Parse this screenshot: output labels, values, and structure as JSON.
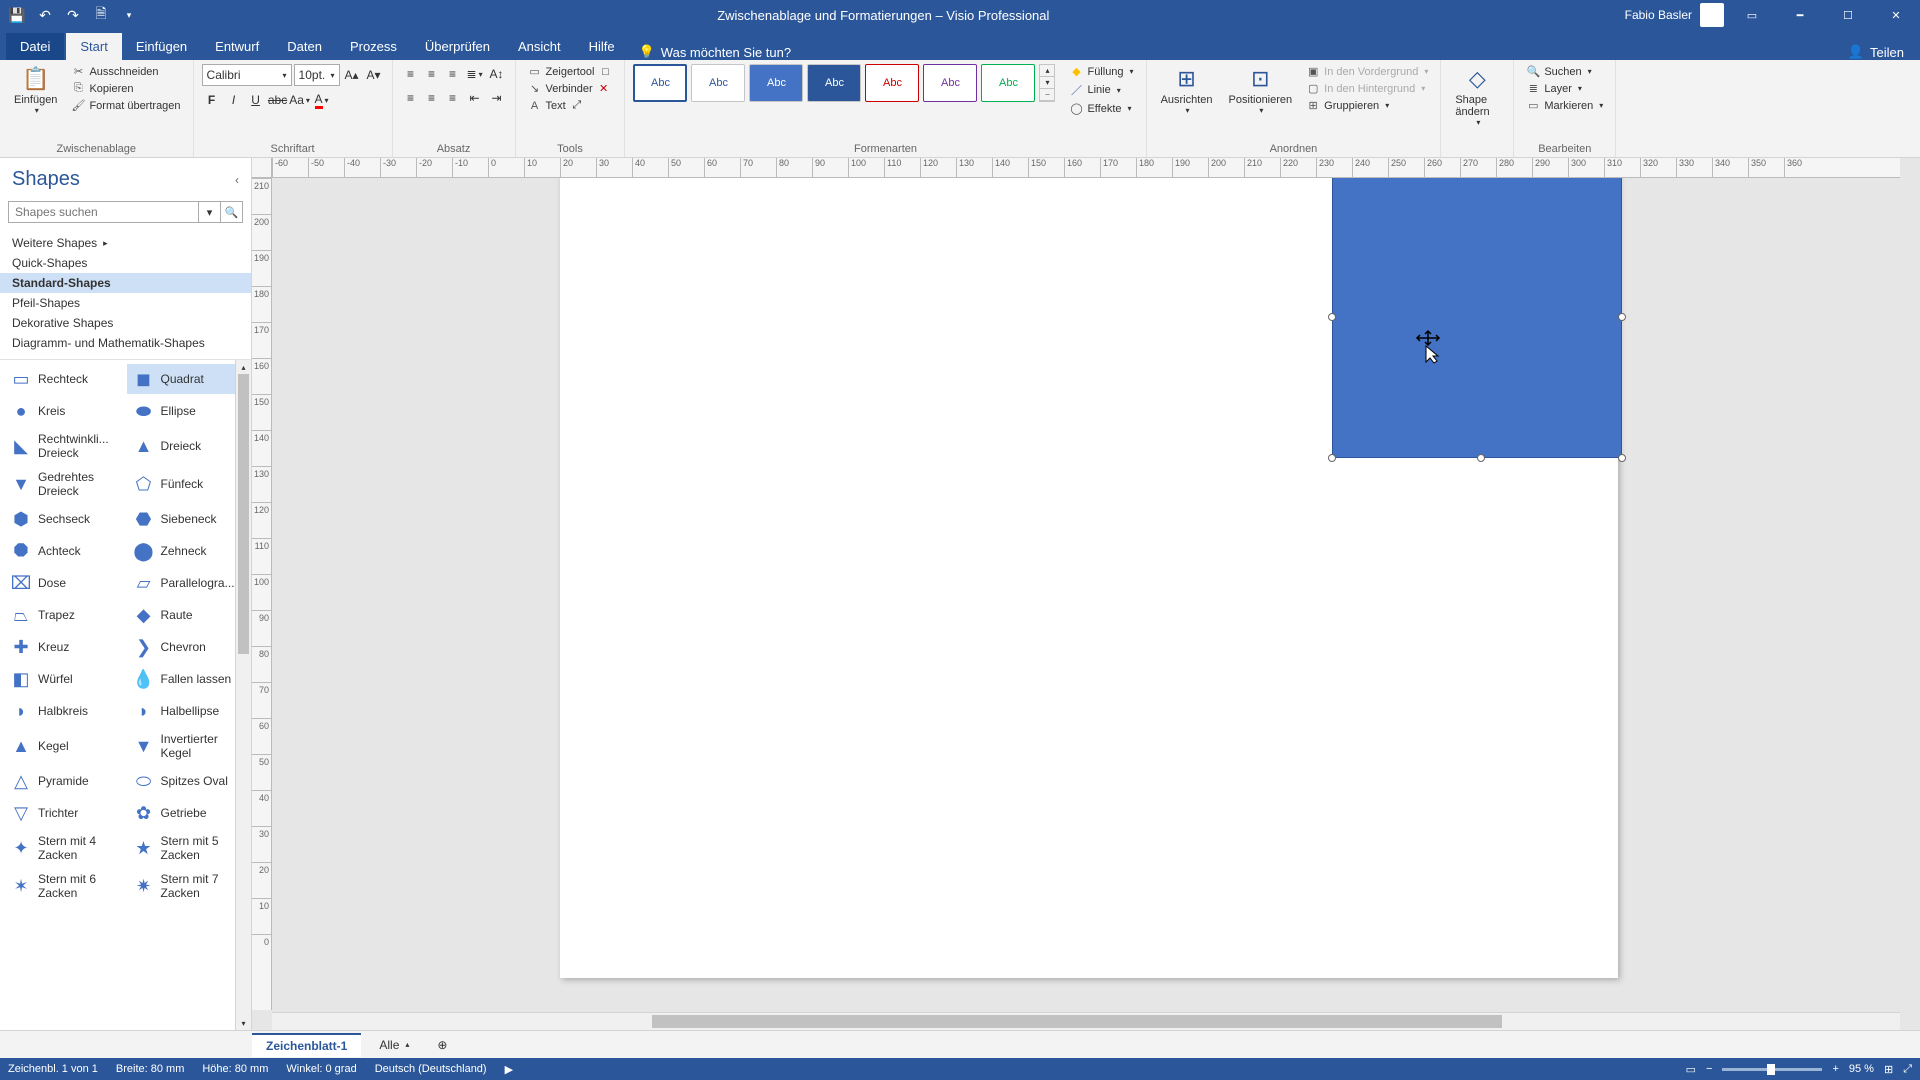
{
  "title": "Zwischenablage und Formatierungen  –  Visio Professional",
  "user": "Fabio Basler",
  "qat": {
    "save": "💾",
    "undo": "↶",
    "redo": "↷",
    "new": "🗎"
  },
  "tabs": [
    "Datei",
    "Start",
    "Einfügen",
    "Entwurf",
    "Daten",
    "Prozess",
    "Überprüfen",
    "Ansicht",
    "Hilfe"
  ],
  "tellme_placeholder": "Was möchten Sie tun?",
  "share": "Teilen",
  "ribbon": {
    "clipboard": {
      "paste": "Einfügen",
      "cut": "Ausschneiden",
      "copy": "Kopieren",
      "painter": "Format übertragen",
      "group": "Zwischenablage"
    },
    "font": {
      "name": "Calibri",
      "size": "10pt.",
      "group": "Schriftart"
    },
    "paragraph": {
      "group": "Absatz"
    },
    "tools": {
      "pointer": "Zeigertool",
      "connector": "Verbinder",
      "text": "Text",
      "group": "Tools"
    },
    "styles": {
      "abc": "Abc",
      "group": "Formenarten",
      "fill": "Füllung",
      "line": "Linie",
      "effects": "Effekte"
    },
    "arrange": {
      "align": "Ausrichten",
      "position": "Positionieren",
      "front": "In den Vordergrund",
      "back": "In den Hintergrund",
      "groupcmd": "Gruppieren",
      "group": "Anordnen"
    },
    "shape": {
      "change": "Shape ändern",
      "group": ""
    },
    "editing": {
      "find": "Suchen",
      "layer": "Layer",
      "select": "Markieren",
      "group": "Bearbeiten"
    }
  },
  "shapes_panel": {
    "title": "Shapes",
    "search_placeholder": "Shapes suchen",
    "stencils": [
      "Weitere Shapes",
      "Quick-Shapes",
      "Standard-Shapes",
      "Pfeil-Shapes",
      "Dekorative Shapes",
      "Diagramm- und Mathematik-Shapes"
    ],
    "active_stencil": 2,
    "shapes": [
      {
        "n": "Rechteck",
        "i": "▭"
      },
      {
        "n": "Quadrat",
        "i": "◼"
      },
      {
        "n": "Kreis",
        "i": "●"
      },
      {
        "n": "Ellipse",
        "i": "⬬"
      },
      {
        "n": "Rechtwinkli... Dreieck",
        "i": "◣"
      },
      {
        "n": "Dreieck",
        "i": "▲"
      },
      {
        "n": "Gedrehtes Dreieck",
        "i": "▼"
      },
      {
        "n": "Fünfeck",
        "i": "⬠"
      },
      {
        "n": "Sechseck",
        "i": "⬢"
      },
      {
        "n": "Siebeneck",
        "i": "⬣"
      },
      {
        "n": "Achteck",
        "i": "⯃"
      },
      {
        "n": "Zehneck",
        "i": "⬤"
      },
      {
        "n": "Dose",
        "i": "⌧"
      },
      {
        "n": "Parallelogra...",
        "i": "▱"
      },
      {
        "n": "Trapez",
        "i": "⏢"
      },
      {
        "n": "Raute",
        "i": "◆"
      },
      {
        "n": "Kreuz",
        "i": "✚"
      },
      {
        "n": "Chevron",
        "i": "❯"
      },
      {
        "n": "Würfel",
        "i": "◧"
      },
      {
        "n": "Fallen lassen",
        "i": "💧"
      },
      {
        "n": "Halbkreis",
        "i": "◗"
      },
      {
        "n": "Halbellipse",
        "i": "◗"
      },
      {
        "n": "Kegel",
        "i": "▲"
      },
      {
        "n": "Invertierter Kegel",
        "i": "▼"
      },
      {
        "n": "Pyramide",
        "i": "△"
      },
      {
        "n": "Spitzes Oval",
        "i": "⬭"
      },
      {
        "n": "Trichter",
        "i": "▽"
      },
      {
        "n": "Getriebe",
        "i": "✿"
      },
      {
        "n": "Stern mit 4 Zacken",
        "i": "✦"
      },
      {
        "n": "Stern mit 5 Zacken",
        "i": "★"
      },
      {
        "n": "Stern mit 6 Zacken",
        "i": "✶"
      },
      {
        "n": "Stern mit 7 Zacken",
        "i": "✷"
      }
    ],
    "selected_shape": 1
  },
  "ruler_h": [
    "-60",
    "-50",
    "-40",
    "-30",
    "-20",
    "-10",
    "0",
    "10",
    "20",
    "30",
    "40",
    "50",
    "60",
    "70",
    "80",
    "90",
    "100",
    "110",
    "120",
    "130",
    "140",
    "150",
    "160",
    "170",
    "180",
    "190",
    "200",
    "210",
    "220",
    "230",
    "240",
    "250",
    "260",
    "270",
    "280",
    "290",
    "300",
    "310",
    "320",
    "330",
    "340",
    "350",
    "360"
  ],
  "ruler_v": [
    "210",
    "200",
    "190",
    "180",
    "170",
    "160",
    "150",
    "140",
    "130",
    "120",
    "110",
    "100",
    "90",
    "80",
    "70",
    "60",
    "50",
    "40",
    "30",
    "20",
    "10",
    "0"
  ],
  "page_tab": "Zeichenblatt-1",
  "all_tab": "Alle",
  "status": {
    "page_info": "Zeichenbl. 1 von 1",
    "width": "Breite: 80 mm",
    "height": "Höhe: 80 mm",
    "angle": "Winkel: 0 grad",
    "lang": "Deutsch (Deutschland)",
    "zoom": "95 %"
  }
}
